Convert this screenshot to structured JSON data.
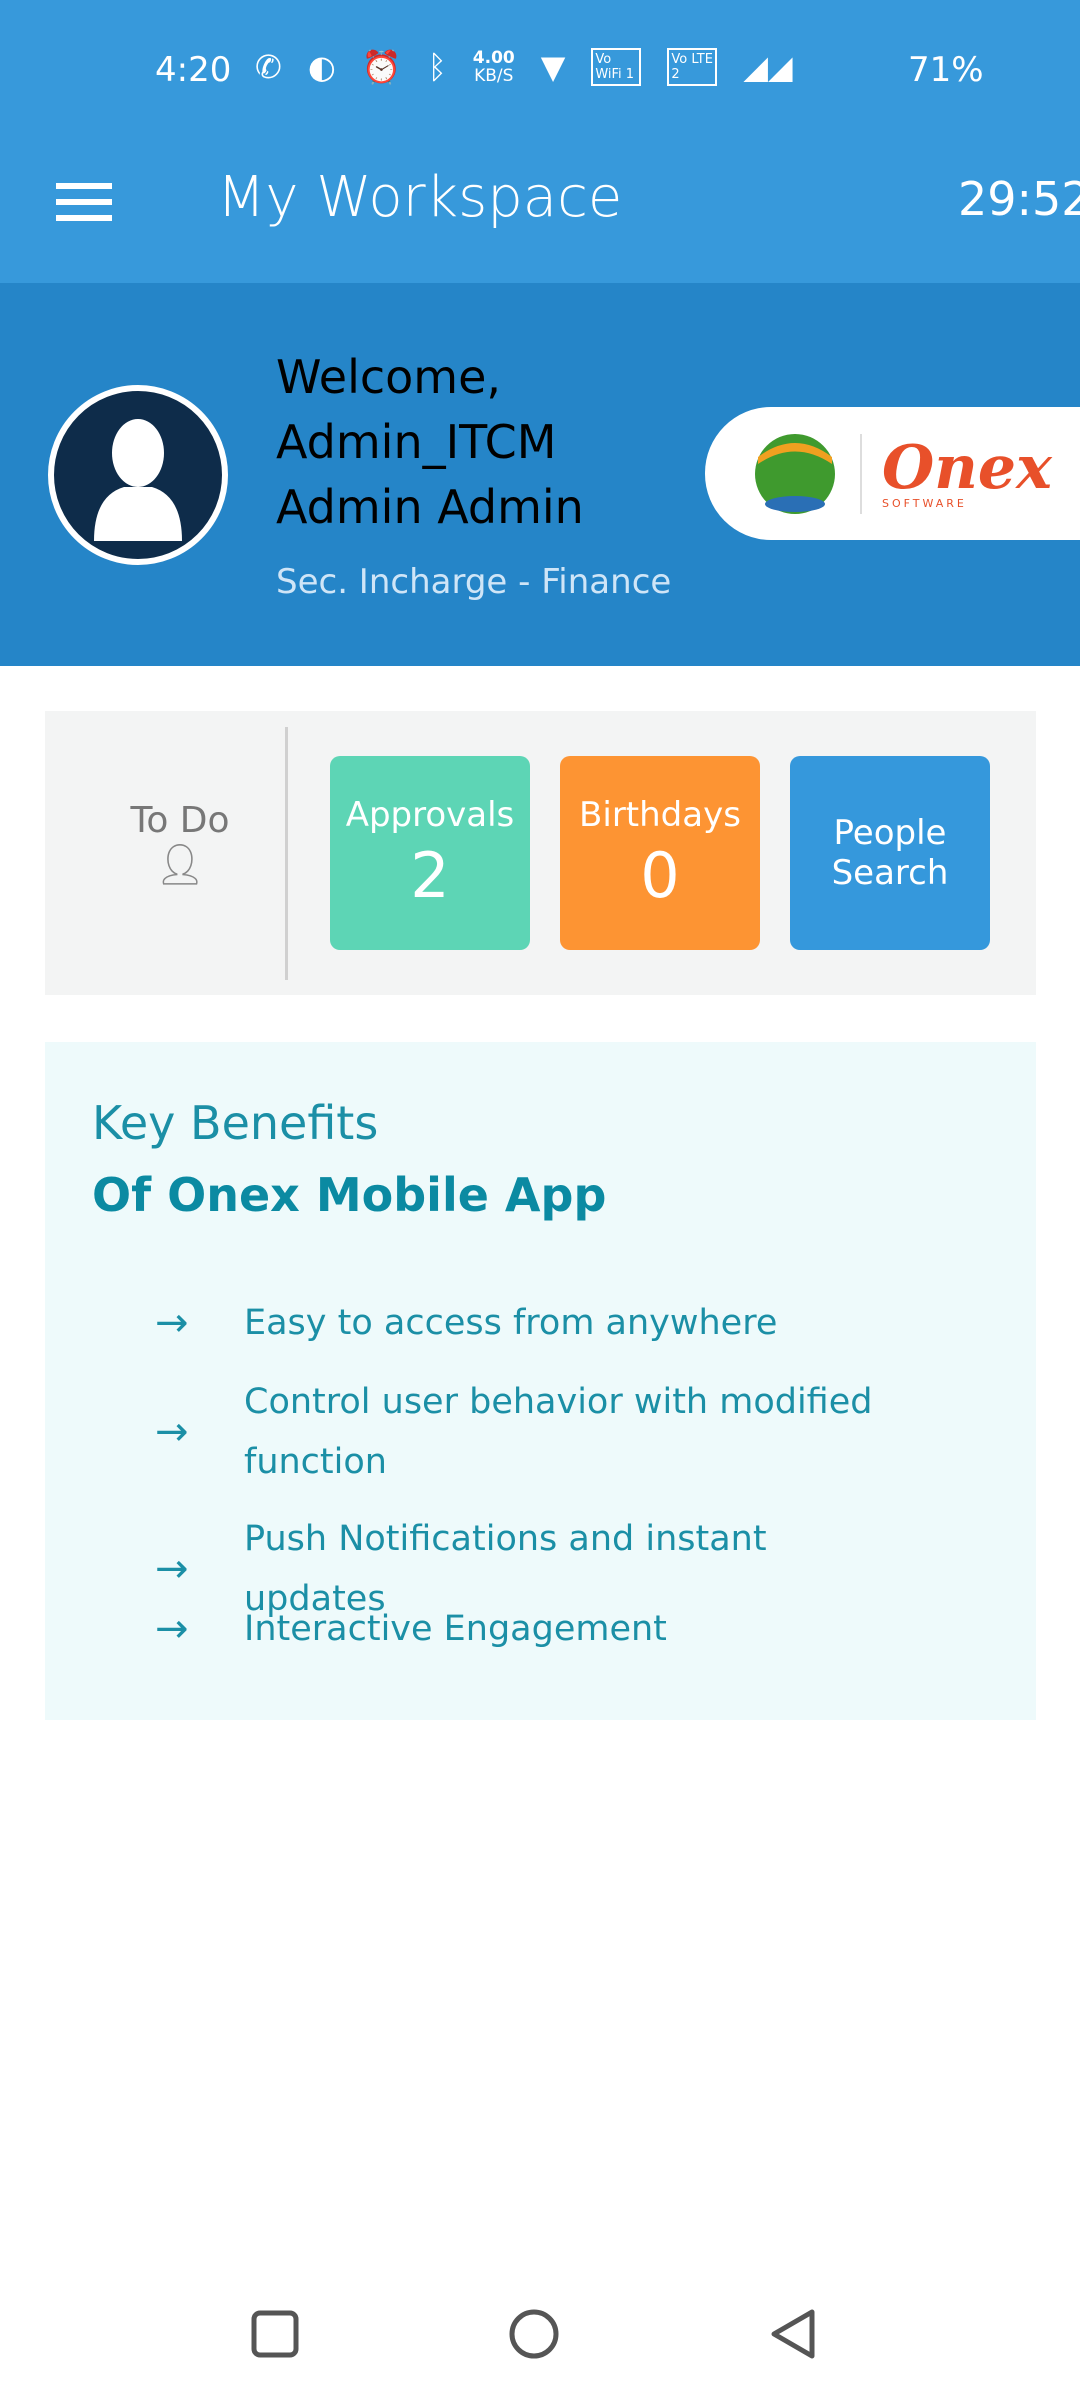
{
  "status_bar": {
    "time": "4:20",
    "network_speed": "4.00",
    "network_speed_unit": "KB/S",
    "vowifi": "Vo WiFi 1",
    "volte": "Vo LTE 2",
    "battery": "71%",
    "icons": [
      "phone-icon",
      "data-saver-icon",
      "alarm-icon",
      "bluetooth-icon",
      "wifi-icon",
      "signal-icon",
      "signal-icon"
    ]
  },
  "app_bar": {
    "title": "My Workspace",
    "timer": "29:52",
    "menu_icon": "hamburger-icon"
  },
  "profile": {
    "welcome": "Welcome,",
    "username": "Admin_ITCM",
    "full_name": "Admin Admin",
    "role": "Sec. Incharge - Finance",
    "logo_text": "Onex",
    "logo_subtext": "SOFTWARE"
  },
  "todo": {
    "label": "To Do",
    "tiles": [
      {
        "label": "Approvals",
        "count": "2",
        "color": "#5dd5b5"
      },
      {
        "label": "Birthdays",
        "count": "0",
        "color": "#fd9433"
      },
      {
        "label_line1": "People",
        "label_line2": "Search",
        "color": "#3598dc"
      }
    ]
  },
  "benefits": {
    "heading": "Key Benefits",
    "subheading": "Of Onex Mobile App",
    "items": [
      "Easy to access from anywhere",
      "Control user behavior with modified function",
      "Push Notifications and instant updates",
      "Interactive Engagement"
    ]
  },
  "colors": {
    "app_bar": "#3799db",
    "header": "#2585c8",
    "accent_text": "#1b8fa6"
  }
}
